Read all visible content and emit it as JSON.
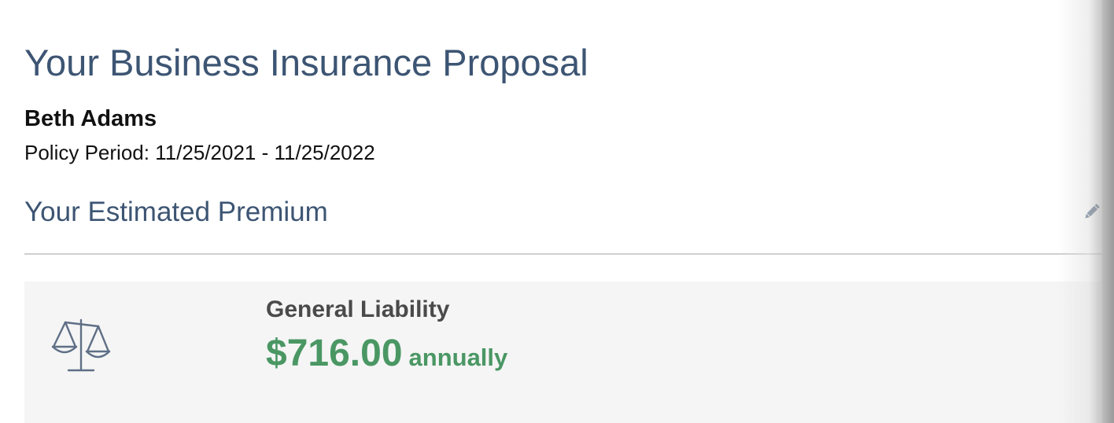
{
  "header": {
    "title": "Your Business Insurance Proposal",
    "customer_name": "Beth Adams",
    "policy_period": "Policy Period: 11/25/2021 - 11/25/2022"
  },
  "premium_section": {
    "title": "Your Estimated Premium",
    "edit_icon": "pencil-icon"
  },
  "coverages": [
    {
      "icon": "scales-icon",
      "name": "General Liability",
      "amount": "$716.00",
      "period": "annually"
    }
  ],
  "colors": {
    "heading": "#3d5573",
    "price": "#4a9764",
    "card_background": "#f5f5f5",
    "divider": "#cfcfcf"
  }
}
